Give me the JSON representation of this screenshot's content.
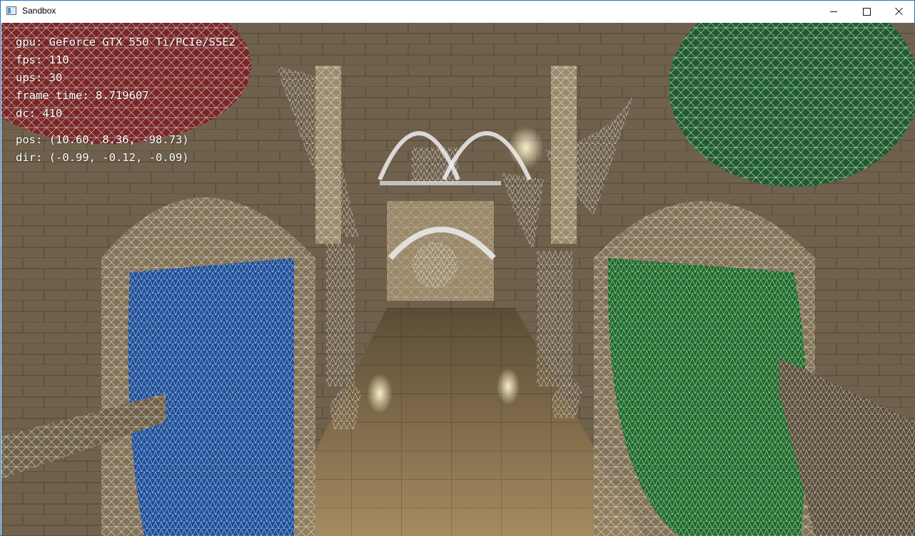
{
  "window": {
    "title": "Sandbox",
    "controls": {
      "minimize": "minimize",
      "maximize": "maximize",
      "close": "close"
    }
  },
  "hud": {
    "gpu": "gpu: GeForce GTX 550 Ti/PCIe/SSE2",
    "fps": "fps: 110",
    "ups": "ups: 30",
    "frame_time": "frame time: 8.719607",
    "dc": "dc: 410",
    "pos": "pos: (10.60, 8.36, -98.73)",
    "dir": "dir: (-0.99, -0.12, -0.09)"
  },
  "colors": {
    "titlebar_border": "#1979ca",
    "stone": "#8a7a60",
    "floor": "#a88d63",
    "curtain_blue": "#1d4f9a",
    "curtain_green": "#1e6b2a",
    "curtain_red": "#8a2a2a",
    "wire": "#e8e8e8"
  }
}
